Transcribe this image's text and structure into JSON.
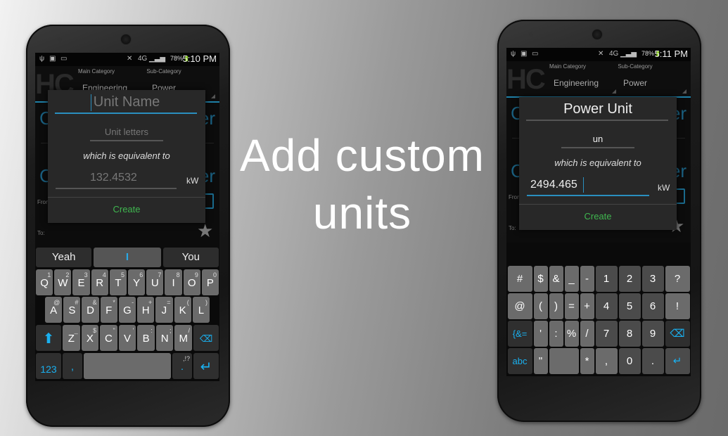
{
  "headline": {
    "line1": "Add custom",
    "line2": "units"
  },
  "phones": [
    {
      "status": {
        "battery": "78%",
        "time": "5:10 PM"
      },
      "header": {
        "logo": "HC",
        "main_label": "Main Category",
        "sub_label": "Sub-Category",
        "main_value": "Engineering",
        "sub_value": "Power"
      },
      "background": {
        "frag_left": "C",
        "frag_right": "er",
        "from_label": "From",
        "to_label": "To:"
      },
      "dialog": {
        "name": {
          "value": "",
          "placeholder": "Unit Name"
        },
        "letters": {
          "value": "",
          "placeholder": "Unit letters"
        },
        "equivalent_text": "which is equivalent to",
        "amount": {
          "value": "",
          "placeholder": "132.4532"
        },
        "unit": "kW",
        "create_label": "Create"
      },
      "keyboard": {
        "type": "qwerty",
        "suggestions": [
          "Yeah",
          "I",
          "You"
        ],
        "rows": [
          [
            [
              "Q",
              "1"
            ],
            [
              "W",
              "2"
            ],
            [
              "E",
              "3"
            ],
            [
              "R",
              "4"
            ],
            [
              "T",
              "5"
            ],
            [
              "Y",
              "6"
            ],
            [
              "U",
              "7"
            ],
            [
              "I",
              "8"
            ],
            [
              "O",
              "9"
            ],
            [
              "P",
              "0"
            ]
          ],
          [
            [
              "A",
              "@"
            ],
            [
              "S",
              "#"
            ],
            [
              "D",
              "&"
            ],
            [
              "F",
              "*"
            ],
            [
              "G",
              "-"
            ],
            [
              "H",
              "+"
            ],
            [
              "J",
              "="
            ],
            [
              "K",
              "("
            ],
            [
              "L",
              ")"
            ]
          ],
          [
            [
              "Z",
              "_"
            ],
            [
              "X",
              "$"
            ],
            [
              "C",
              "\""
            ],
            [
              "V",
              "'"
            ],
            [
              "B",
              ":"
            ],
            [
              "N",
              ";"
            ],
            [
              "M",
              "/"
            ]
          ]
        ],
        "numbers_label": "123",
        "comma": ",",
        "period": ".",
        "period_hint": ",!?"
      }
    },
    {
      "status": {
        "battery": "78%",
        "time": "5:11 PM"
      },
      "header": {
        "logo": "HC",
        "main_label": "Main Category",
        "sub_label": "Sub-Category",
        "main_value": "Engineering",
        "sub_value": "Power"
      },
      "background": {
        "frag_left": "C",
        "frag_right": "er",
        "from_label": "From",
        "to_label": "To:"
      },
      "dialog": {
        "name": {
          "value": "Power Unit",
          "placeholder": ""
        },
        "letters": {
          "value": "un",
          "placeholder": ""
        },
        "equivalent_text": "which is equivalent to",
        "amount": {
          "value": "2494.465",
          "placeholder": ""
        },
        "unit": "kW",
        "create_label": "Create"
      },
      "keyboard": {
        "type": "symbols",
        "rows": [
          [
            "#",
            "$",
            "&",
            "_",
            "-",
            "1",
            "2",
            "3",
            "?"
          ],
          [
            "@",
            "(",
            ")",
            "=",
            "+",
            "4",
            "5",
            "6",
            "!"
          ],
          [
            "{&=",
            "'",
            ":",
            "%",
            "/",
            "7",
            "8",
            "9",
            "⌫"
          ],
          [
            "abc",
            "\"",
            "",
            "*",
            ",",
            "0",
            ".",
            "↵"
          ]
        ]
      }
    }
  ],
  "colors": {
    "accent": "#2a8fbf",
    "create": "#3fb64f",
    "key_blue": "#1ab0ef"
  }
}
